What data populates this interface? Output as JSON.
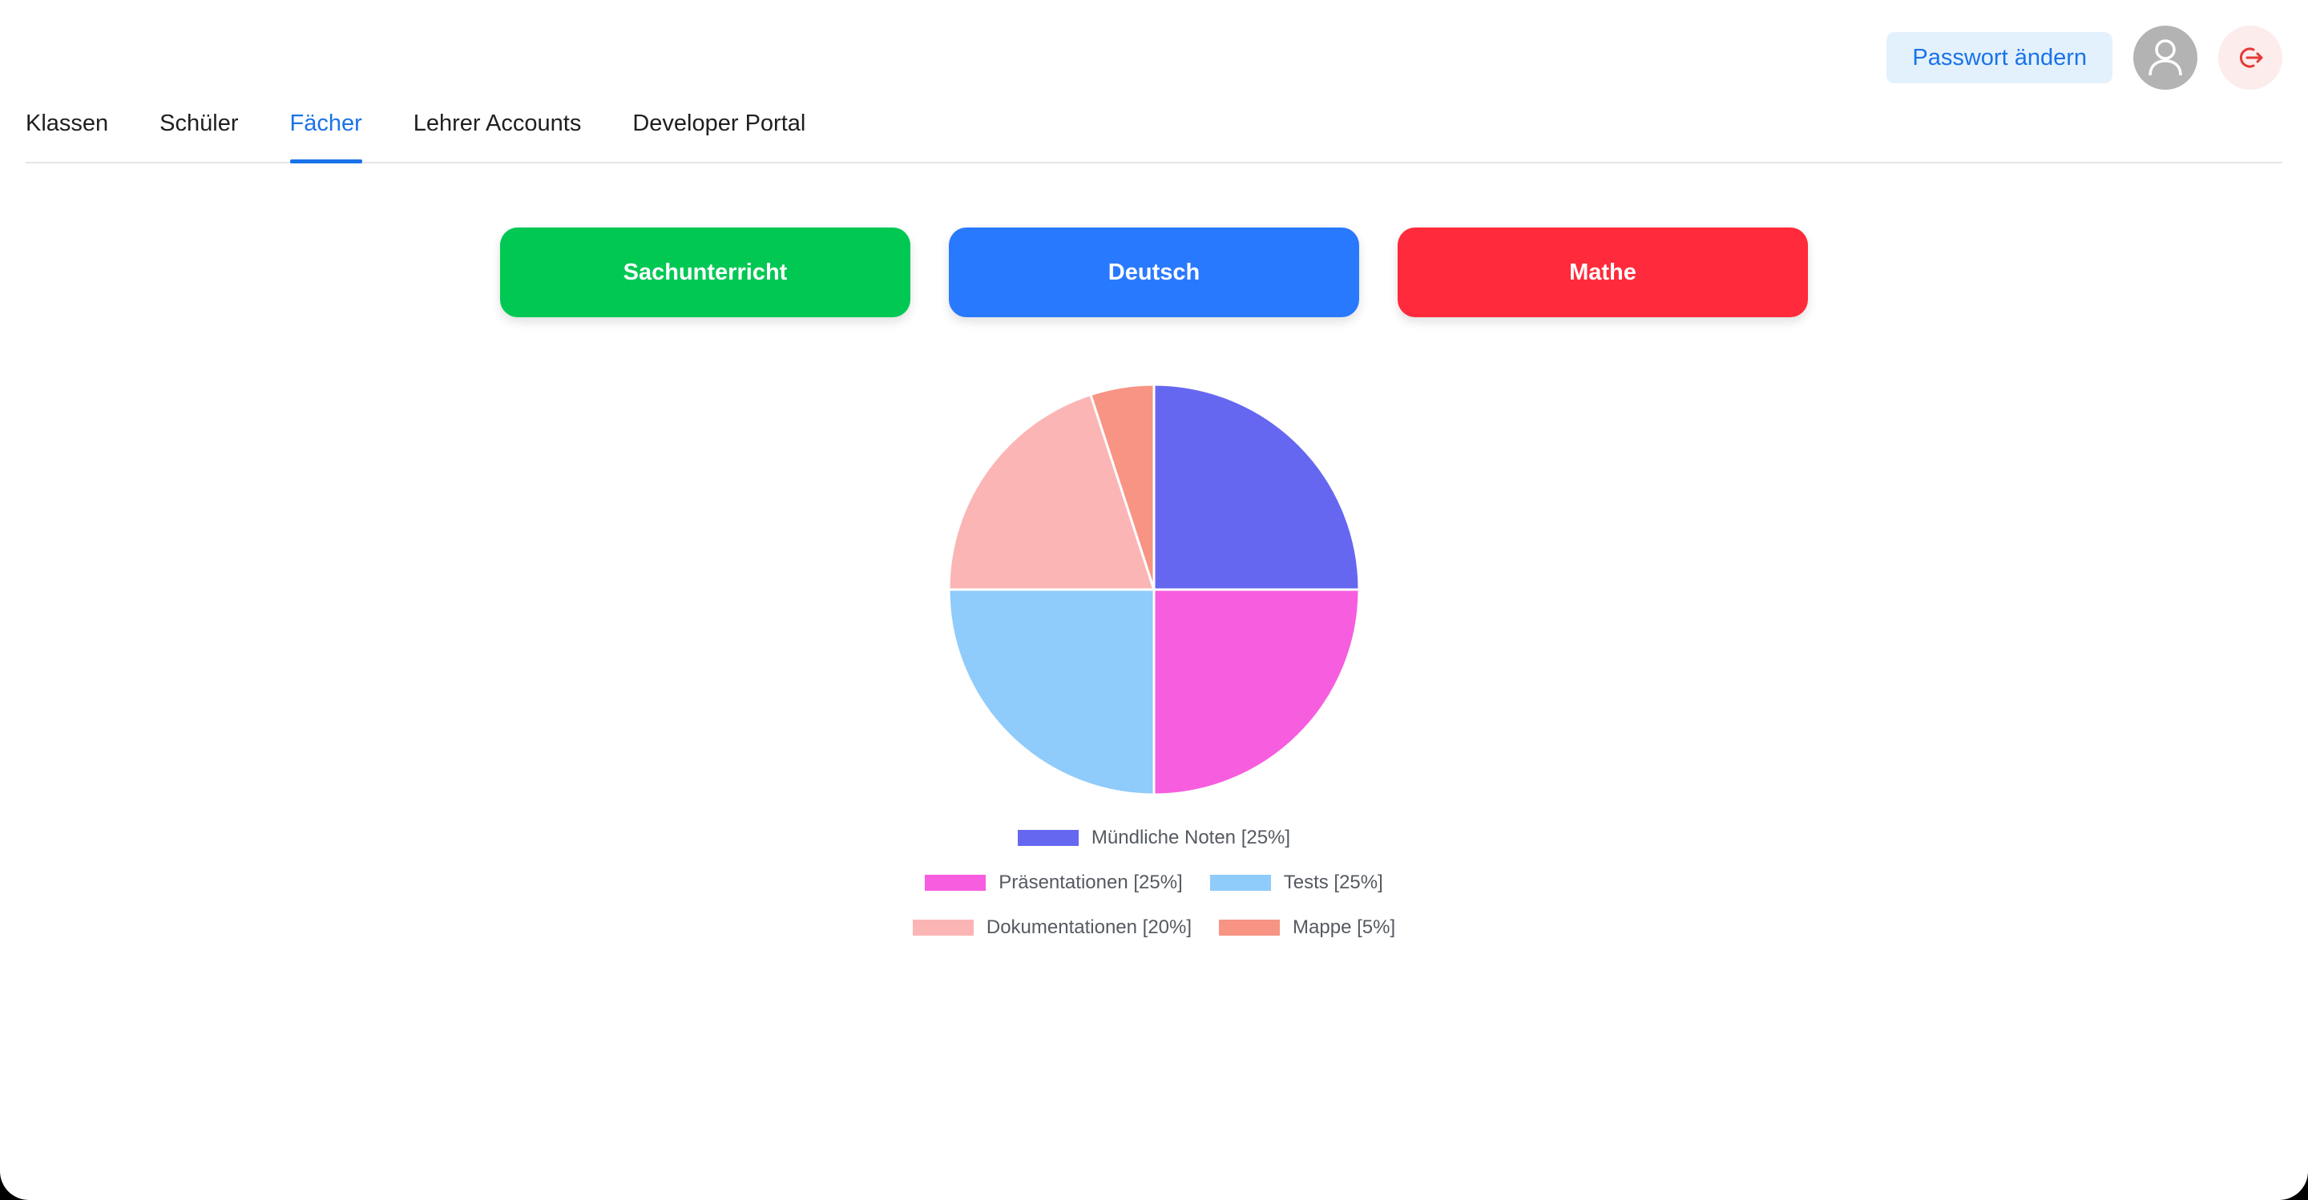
{
  "header": {
    "password_button": "Passwort ändern",
    "avatar_icon": "user-icon",
    "logout_icon": "logout-icon"
  },
  "tabs": [
    {
      "label": "Klassen",
      "active": false
    },
    {
      "label": "Schüler",
      "active": false
    },
    {
      "label": "Fächer",
      "active": true
    },
    {
      "label": "Lehrer Accounts",
      "active": false
    },
    {
      "label": "Developer Portal",
      "active": false
    }
  ],
  "subjects": [
    {
      "label": "Sachunterricht",
      "color": "#00c853"
    },
    {
      "label": "Deutsch",
      "color": "#2979ff"
    },
    {
      "label": "Mathe",
      "color": "#ff2a3b"
    }
  ],
  "colors": {
    "accent": "#1a73e8",
    "logout": "#e53935"
  },
  "chart_data": {
    "type": "pie",
    "slices": [
      {
        "label": "Mündliche Noten [25%]",
        "value": 25,
        "color": "#6667f0"
      },
      {
        "label": "Präsentationen [25%]",
        "value": 25,
        "color": "#f75ddf"
      },
      {
        "label": "Tests [25%]",
        "value": 25,
        "color": "#8fcbfb"
      },
      {
        "label": "Dokumentationen [20%]",
        "value": 20,
        "color": "#fbb5b5"
      },
      {
        "label": "Mappe [5%]",
        "value": 5,
        "color": "#f79483"
      }
    ],
    "legend_position": "bottom"
  }
}
